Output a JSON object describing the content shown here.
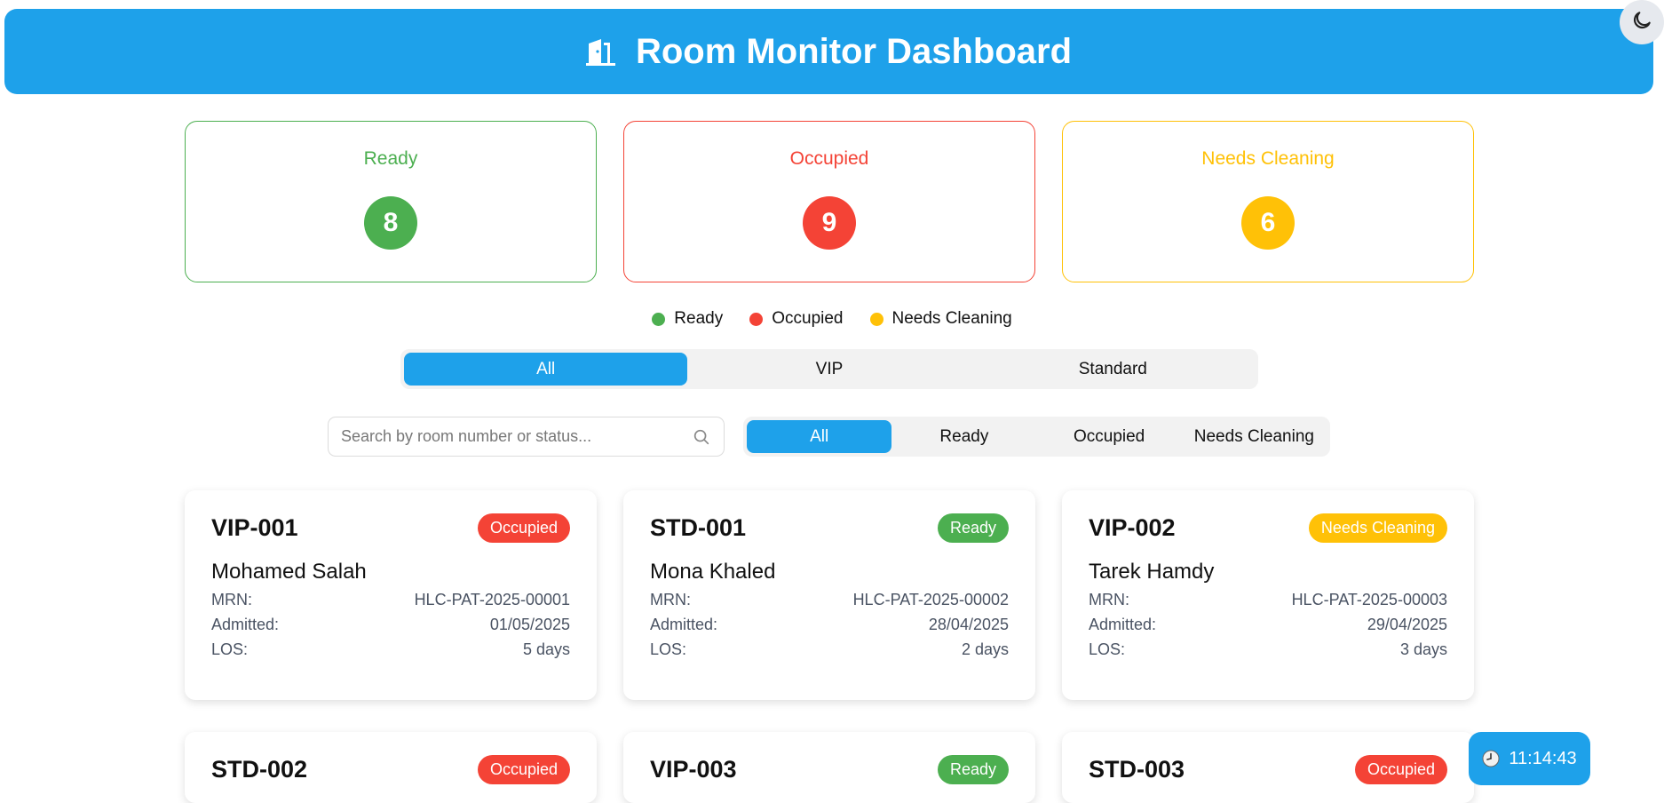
{
  "header": {
    "title": "Room Monitor Dashboard",
    "icon": "door-icon"
  },
  "theme_toggle": {
    "icon": "moon-icon"
  },
  "colors": {
    "accent": "#1ea1ea",
    "ready": "#4caf50",
    "occupied": "#f44336",
    "needs_cleaning": "#ffc107"
  },
  "stats": [
    {
      "label": "Ready",
      "count": "8"
    },
    {
      "label": "Occupied",
      "count": "9"
    },
    {
      "label": "Needs Cleaning",
      "count": "6"
    }
  ],
  "legend": [
    {
      "label": "Ready"
    },
    {
      "label": "Occupied"
    },
    {
      "label": "Needs Cleaning"
    }
  ],
  "type_tabs": [
    {
      "label": "All",
      "active": true
    },
    {
      "label": "VIP",
      "active": false
    },
    {
      "label": "Standard",
      "active": false
    }
  ],
  "search": {
    "placeholder": "Search by room number or status...",
    "value": "",
    "icon": "search-icon"
  },
  "status_filters": [
    {
      "label": "All",
      "active": true
    },
    {
      "label": "Ready",
      "active": false
    },
    {
      "label": "Occupied",
      "active": false
    },
    {
      "label": "Needs Cleaning",
      "active": false
    }
  ],
  "info_labels": {
    "mrn": "MRN:",
    "admitted": "Admitted:",
    "los": "LOS:"
  },
  "rooms": [
    {
      "id": "VIP-001",
      "status": "Occupied",
      "patient": "Mohamed Salah",
      "mrn": "HLC-PAT-2025-00001",
      "admitted": "01/05/2025",
      "los": "5 days"
    },
    {
      "id": "STD-001",
      "status": "Ready",
      "patient": "Mona Khaled",
      "mrn": "HLC-PAT-2025-00002",
      "admitted": "28/04/2025",
      "los": "2 days"
    },
    {
      "id": "VIP-002",
      "status": "Needs Cleaning",
      "patient": "Tarek Hamdy",
      "mrn": "HLC-PAT-2025-00003",
      "admitted": "29/04/2025",
      "los": "3 days"
    },
    {
      "id": "STD-002",
      "status": "Occupied"
    },
    {
      "id": "VIP-003",
      "status": "Ready"
    },
    {
      "id": "STD-003",
      "status": "Occupied"
    }
  ],
  "clock": {
    "time": "11:14:43",
    "icon": "clock-icon"
  }
}
